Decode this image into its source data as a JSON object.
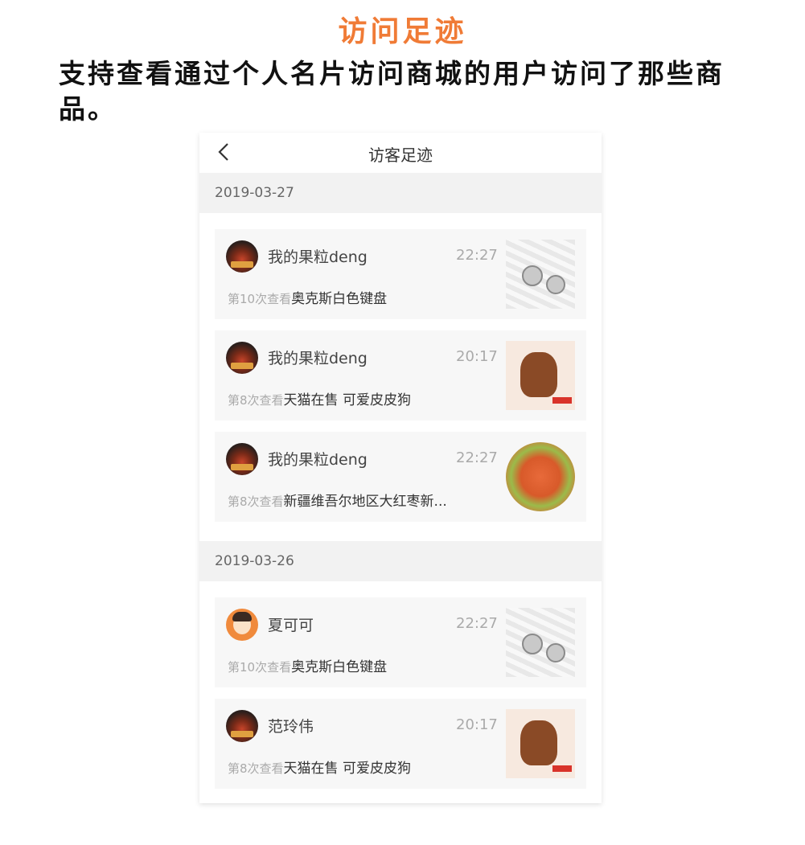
{
  "header": {
    "title": "访问足迹",
    "description": "支持查看通过个人名片访问商城的用户访问了那些商品。"
  },
  "nav": {
    "title": "访客足迹",
    "back_icon": "chevron-left-icon"
  },
  "groups": [
    {
      "date": "2019-03-27",
      "items": [
        {
          "name": "我的果粒deng",
          "time": "22:27",
          "count": "第10次查看",
          "product": "奥克斯白色键盘"
        },
        {
          "name": "我的果粒deng",
          "time": "20:17",
          "count": "第8次查看",
          "product": "天猫在售  可爱皮皮狗"
        },
        {
          "name": "我的果粒deng",
          "time": "22:27",
          "count": "第8次查看",
          "product": "新疆维吾尔地区大红枣新..."
        }
      ]
    },
    {
      "date": "2019-03-26",
      "items": [
        {
          "name": "夏可可",
          "time": "22:27",
          "count": "第10次查看",
          "product": "奥克斯白色键盘"
        },
        {
          "name": "范玲伟",
          "time": "20:17",
          "count": "第8次查看",
          "product": "天猫在售  可爱皮皮狗"
        }
      ]
    }
  ],
  "colors": {
    "accent": "#f07b36",
    "date_header_bg": "#f2f2f2",
    "card_bg": "#f7f7f7"
  }
}
